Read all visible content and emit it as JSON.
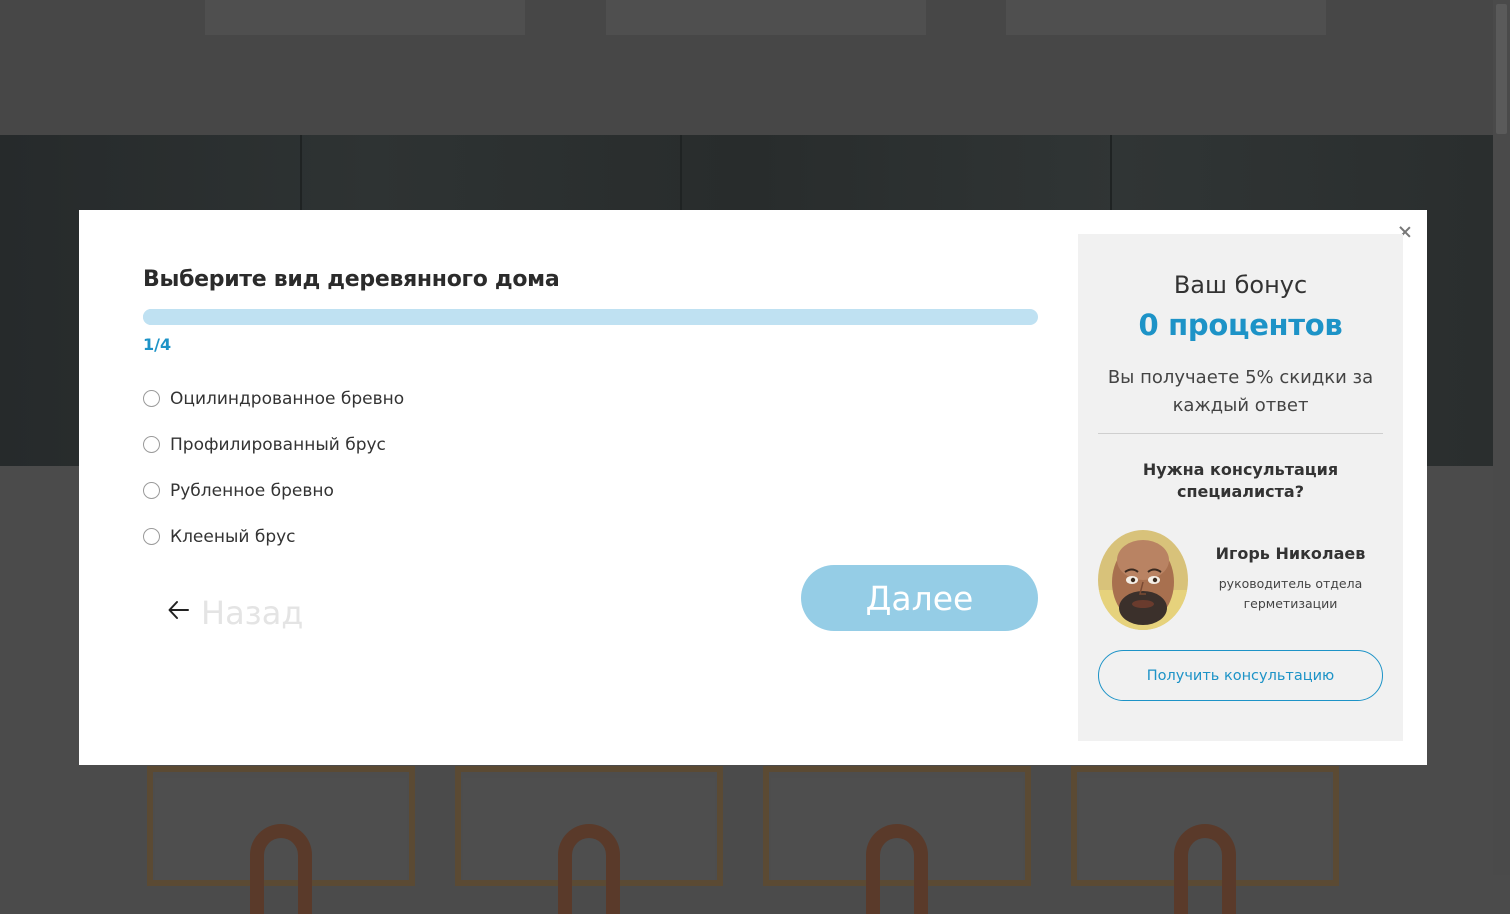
{
  "quiz": {
    "title": "Выберите вид деревянного дома",
    "progress_fraction": 0.25,
    "step": "1/4",
    "options": [
      {
        "label": "Оцилиндрованное бревно",
        "selected": false
      },
      {
        "label": "Профилированный брус",
        "selected": false
      },
      {
        "label": "Рубленное бревно",
        "selected": false
      },
      {
        "label": "Клееный брус",
        "selected": false
      }
    ],
    "back_label": "Назад",
    "next_label": "Далее"
  },
  "bonus": {
    "caption": "Ваш бонус",
    "value": "0 процентов",
    "note": "Вы получаете 5% скидки за каждый ответ"
  },
  "consultation": {
    "question": "Нужна консультация специалиста?",
    "expert_name": "Игорь Николаев",
    "expert_role": "руководитель отдела герметизации",
    "button_label": "Получить консультацию"
  },
  "colors": {
    "accent": "#1d93c7",
    "progress_track": "#bfe1f2",
    "next_button": "#95cde6",
    "side_panel": "#f1f1f1",
    "overlay": "#4b4b4b"
  },
  "icons": {
    "close": "close-icon",
    "back": "arrow-left-icon",
    "option": "radio-icon"
  }
}
